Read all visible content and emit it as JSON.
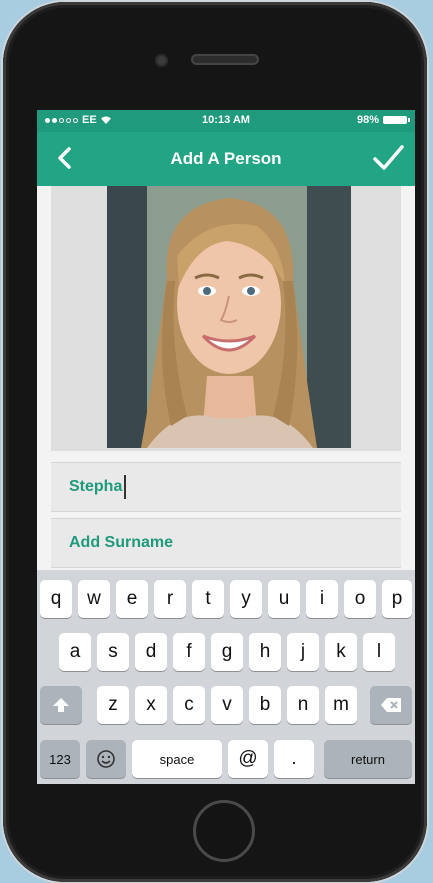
{
  "status": {
    "carrier": "EE",
    "time": "10:13 AM",
    "battery": "98%"
  },
  "nav": {
    "title": "Add A Person"
  },
  "form": {
    "first_name_value": "Stepha",
    "surname_placeholder": "Add Surname"
  },
  "keyboard": {
    "row1": [
      "q",
      "w",
      "e",
      "r",
      "t",
      "y",
      "u",
      "i",
      "o",
      "p"
    ],
    "row2": [
      "a",
      "s",
      "d",
      "f",
      "g",
      "h",
      "j",
      "k",
      "l"
    ],
    "row3": [
      "z",
      "x",
      "c",
      "v",
      "b",
      "n",
      "m"
    ],
    "numbers_label": "123",
    "space_label": "space",
    "at_label": "@",
    "period_label": ".",
    "return_label": "return"
  },
  "colors": {
    "accent": "#22a585",
    "status_bar": "#1f9a7c",
    "field_text": "#1f9a7c"
  }
}
